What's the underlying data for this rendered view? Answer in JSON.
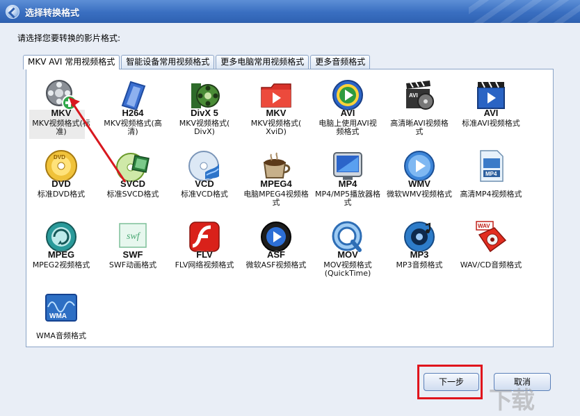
{
  "window": {
    "title": "选择转换格式"
  },
  "prompt": "请选择您要转换的影片格式:",
  "tabs": [
    {
      "label": "MKV AVI 常用视频格式",
      "active": true
    },
    {
      "label": "智能设备常用视频格式",
      "active": false
    },
    {
      "label": "更多电脑常用视频格式",
      "active": false
    },
    {
      "label": "更多音频格式",
      "active": false
    }
  ],
  "formats": [
    {
      "name": "MKV",
      "desc": "MKV视频格式(标\n准)",
      "icon": "film-reel-add-icon",
      "selected": true
    },
    {
      "name": "H264",
      "desc": "MKV视频格式(高\n清)",
      "icon": "film-strip-blue-icon"
    },
    {
      "name": "DivX 5",
      "desc": "MKV视频格式(\nDivX)",
      "icon": "film-reel-green-icon"
    },
    {
      "name": "MKV",
      "desc": "MKV视频格式(\nXviD)",
      "icon": "video-folder-red-icon"
    },
    {
      "name": "AVI",
      "desc": "电脑上使用AVI视\n频格式",
      "icon": "media-player-icon"
    },
    {
      "name": "",
      "desc": "高清晰AVI视频格\n式",
      "icon": "clapper-avi-icon"
    },
    {
      "name": "AVI",
      "desc": "标准AVI视频格式",
      "icon": "clapper-blue-icon"
    },
    {
      "name": "DVD",
      "desc": "标准DVD格式",
      "icon": "dvd-disc-icon"
    },
    {
      "name": "SVCD",
      "desc": "标准SVCD格式",
      "icon": "svcd-disc-icon"
    },
    {
      "name": "VCD",
      "desc": "标准VCD格式",
      "icon": "vcd-disc-icon"
    },
    {
      "name": "MPEG4",
      "desc": "电脑MPEG4视频格\n式",
      "icon": "coffee-cup-icon"
    },
    {
      "name": "MP4",
      "desc": "MP4/MP5播放器格\n式",
      "icon": "mp4-player-icon"
    },
    {
      "name": "WMV",
      "desc": "微软WMV视频格式",
      "icon": "wmv-play-icon"
    },
    {
      "name": "",
      "desc": "高清MP4视频格式",
      "icon": "mp4-file-icon"
    },
    {
      "name": "MPEG",
      "desc": "MPEG2视频格式",
      "icon": "mpeg-refresh-icon"
    },
    {
      "name": "SWF",
      "desc": "SWF动画格式",
      "icon": "swf-file-icon"
    },
    {
      "name": "FLV",
      "desc": "FLV网络视频格式",
      "icon": "flash-icon"
    },
    {
      "name": "ASF",
      "desc": "微软ASF视频格式",
      "icon": "asf-play-icon"
    },
    {
      "name": "MOV",
      "desc": "MOV视频格式\n(QuickTime)",
      "icon": "quicktime-icon"
    },
    {
      "name": "MP3",
      "desc": "MP3音频格式",
      "icon": "mp3-speaker-icon"
    },
    {
      "name": "",
      "desc": "WAV/CD音频格式",
      "icon": "wav-speaker-icon"
    },
    {
      "name": "",
      "desc": "WMA音频格式",
      "icon": "wma-wave-icon"
    }
  ],
  "buttons": {
    "next": "下一步",
    "cancel": "取消"
  },
  "colors": {
    "titlebar": "#3a6fc1",
    "highlight": "#e0141c",
    "arrow": "#d8181f"
  }
}
